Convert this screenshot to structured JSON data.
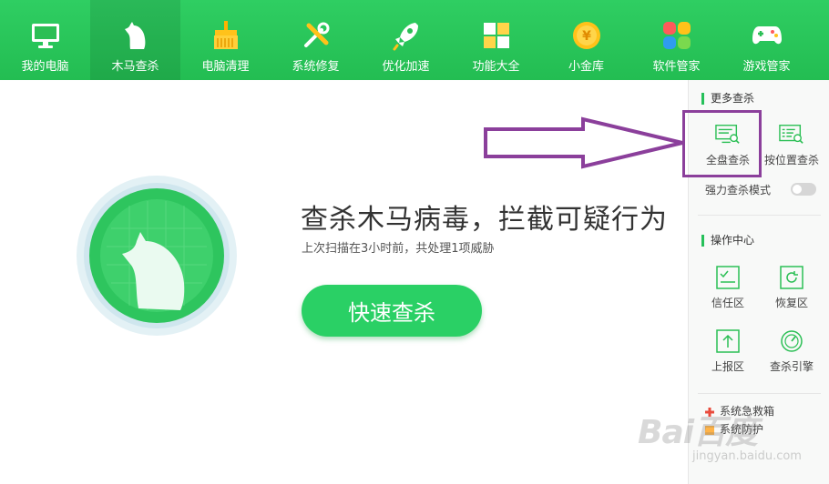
{
  "nav": {
    "items": [
      {
        "label": "我的电脑",
        "icon": "monitor-icon"
      },
      {
        "label": "木马查杀",
        "icon": "horse-icon",
        "active": true
      },
      {
        "label": "电脑清理",
        "icon": "broom-icon"
      },
      {
        "label": "系统修复",
        "icon": "tools-icon"
      },
      {
        "label": "优化加速",
        "icon": "rocket-icon"
      },
      {
        "label": "功能大全",
        "icon": "grid-icon"
      },
      {
        "label": "小金库",
        "icon": "coin-icon"
      },
      {
        "label": "软件管家",
        "icon": "flower-icon"
      },
      {
        "label": "游戏管家",
        "icon": "gamepad-icon"
      }
    ]
  },
  "main": {
    "headline": "查杀木马病毒，拦截可疑行为",
    "subline": "上次扫描在3小时前，共处理1项威胁",
    "scan_button": "快速查杀"
  },
  "sidebar": {
    "more_title": "更多查杀",
    "full_scan": "全盘查杀",
    "location_scan": "按位置查杀",
    "strong_mode": "强力查杀模式",
    "ops_title": "操作中心",
    "trust_zone": "信任区",
    "restore_zone": "恢复区",
    "report_zone": "上报区",
    "engine": "查杀引擎",
    "rescue": "系统急救箱",
    "other_tool": "系统防护"
  },
  "watermark": {
    "logo": "Bai百度",
    "url": "jingyan.baidu.com"
  },
  "colors": {
    "brand_green": "#26c05a",
    "annotation_purple": "#8b3f9b"
  }
}
